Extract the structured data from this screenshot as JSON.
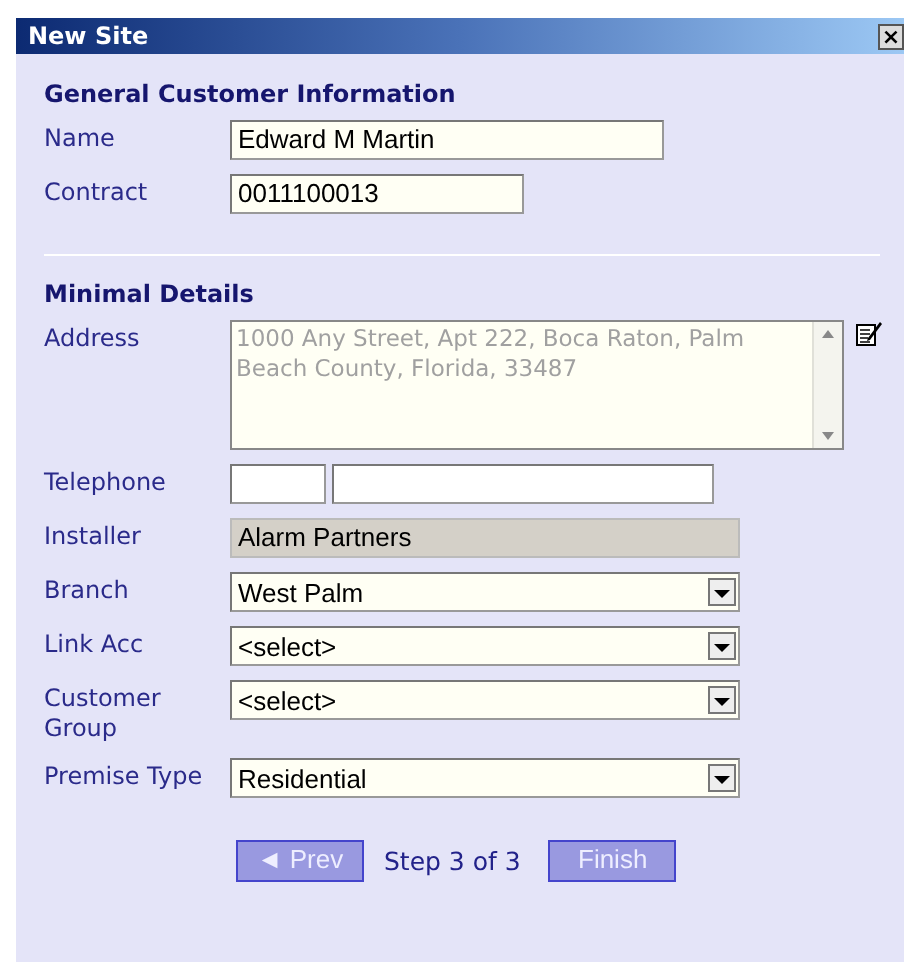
{
  "window": {
    "title": "New Site",
    "close": "×"
  },
  "sections": [
    {
      "heading": "General Customer Information",
      "rows": [
        {
          "label": "Name",
          "kind": "text",
          "value": "Edward M Martin"
        },
        {
          "label": "Contract",
          "kind": "text",
          "value": "0011100013"
        }
      ]
    },
    {
      "heading": "Minimal Details",
      "rows": [
        {
          "label": "Address",
          "kind": "textarea",
          "value": "1000 Any Street, Apt 222, Boca Raton, Palm Beach County, Florida, 33487",
          "disabled": true
        },
        {
          "label": "Telephone",
          "kind": "phone"
        },
        {
          "label": "Installer",
          "kind": "readonly",
          "value": "Alarm Partners"
        },
        {
          "label": "Branch",
          "kind": "select",
          "value": "West Palm"
        },
        {
          "label": "Link Acc",
          "kind": "select",
          "value": "<select>"
        },
        {
          "label": "Customer Group",
          "kind": "select",
          "value": "<select>"
        },
        {
          "label": "Premise Type",
          "kind": "select",
          "value": "Residential"
        }
      ]
    }
  ],
  "nav": {
    "prev": "◄ Prev",
    "step": "Step 3 of 3",
    "finish": "Finish"
  }
}
